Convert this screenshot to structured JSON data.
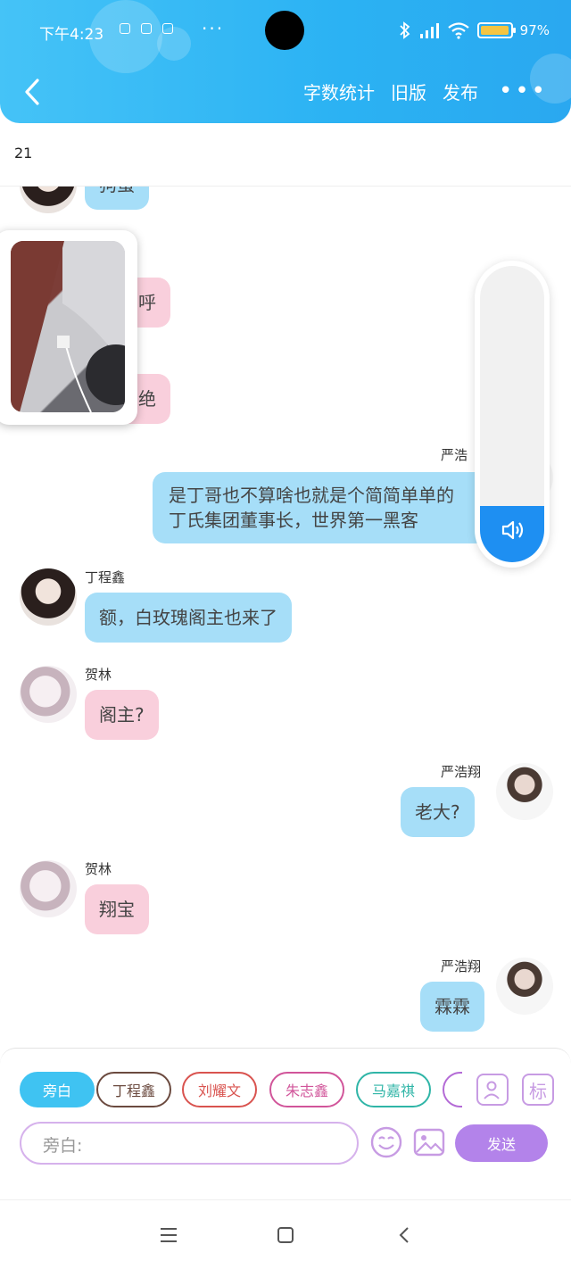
{
  "status_bar": {
    "time": "下午4:23",
    "battery": "97%",
    "battery_level": 0.97
  },
  "header": {
    "actions": [
      "字数统计",
      "旧版",
      "发布"
    ]
  },
  "word_count": "21",
  "messages": [
    {
      "speaker": "丁程鑫",
      "side": "left",
      "text": "狗蛋",
      "color": "blue",
      "show_name": false,
      "avatar": "ding"
    },
    {
      "speaker": "贺林",
      "side": "left",
      "text": "呼",
      "color": "pink",
      "show_name": false,
      "avatar": "he"
    },
    {
      "speaker": "贺林",
      "side": "left",
      "text": "绝",
      "color": "pink",
      "show_name": false,
      "avatar": "he"
    },
    {
      "speaker": "严浩翔",
      "side": "right",
      "text": "是丁哥也不算啥也就是个简简单单的丁氏集团董事长，世界第一黑客",
      "line1": "是丁哥也不算啥也就是个简简单单的",
      "line2": "丁氏集团董事长，世界第一黑客",
      "color": "blue",
      "name_display": "严浩"
    },
    {
      "speaker": "丁程鑫",
      "side": "left",
      "text": "额，白玫瑰阁主也来了",
      "color": "blue",
      "avatar": "ding"
    },
    {
      "speaker": "贺林",
      "side": "left",
      "text": "阁主?",
      "color": "pink",
      "avatar": "he"
    },
    {
      "speaker": "严浩翔",
      "side": "right",
      "text": "老大?",
      "color": "blue",
      "avatar": "yan"
    },
    {
      "speaker": "贺林",
      "side": "left",
      "text": "翔宝",
      "color": "pink",
      "avatar": "he"
    },
    {
      "speaker": "严浩翔",
      "side": "right",
      "text": "霖霖",
      "color": "blue",
      "avatar": "yan"
    }
  ],
  "volume": {
    "level": 0.19
  },
  "composer": {
    "roles": [
      {
        "label": "旁白",
        "active": true,
        "color": "#3fc3f2"
      },
      {
        "label": "丁程鑫",
        "active": false,
        "color": "#6b4a3f"
      },
      {
        "label": "刘耀文",
        "active": false,
        "color": "#d9534f"
      },
      {
        "label": "朱志鑫",
        "active": false,
        "color": "#d1559a"
      },
      {
        "label": "马嘉祺",
        "active": false,
        "color": "#2fb5a7"
      }
    ],
    "tag_button": "标",
    "placeholder": "旁白:",
    "send_label": "发送"
  },
  "colors": {
    "accent": "#2bb2f3",
    "send": "#b383ea",
    "bubble_blue": "#a6def8",
    "bubble_pink": "#f9cfdc"
  }
}
